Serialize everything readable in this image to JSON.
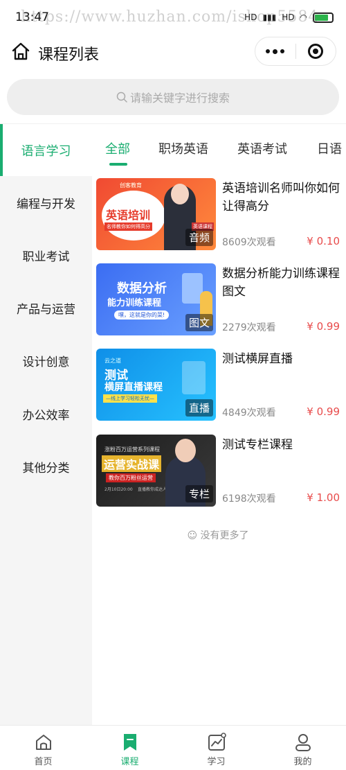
{
  "status_bar": {
    "time": "13:47",
    "network_1": "HD",
    "network_2": "HD"
  },
  "watermark": "https://www.huzhan.com/ishop5584",
  "header": {
    "title": "课程列表"
  },
  "search": {
    "placeholder": "请输关键字进行搜索"
  },
  "primary_category": "语言学习",
  "tabs": [
    "全部",
    "职场英语",
    "英语考试",
    "日语"
  ],
  "sidebar": {
    "items": [
      "编程与开发",
      "职业考试",
      "产品与运营",
      "设计创意",
      "办公效率",
      "其他分类"
    ]
  },
  "courses": [
    {
      "title": "英语培训名师叫你如何让得高分",
      "views": "8609次观看",
      "price": "¥ 0.10",
      "badge": "音频",
      "thumb_top": "创客教育",
      "thumb_main": "英语培训",
      "thumb_sub": "名师教你如何得高分",
      "thumb_tag": "英语课程"
    },
    {
      "title": "数据分析能力训练课程图文",
      "views": "2279次观看",
      "price": "¥ 0.99",
      "badge": "图文",
      "thumb_main": "数据分析",
      "thumb_main2": "能力训练课程",
      "thumb_sub": "嘿，这就是你的菜!"
    },
    {
      "title": "测试横屏直播",
      "views": "4849次观看",
      "price": "¥ 0.99",
      "badge": "直播",
      "thumb_top": "云之道",
      "thumb_main": "测试",
      "thumb_main2": "横屏直播课程",
      "thumb_sub": "—线上学习轻松无忧—"
    },
    {
      "title": "测试专栏课程",
      "views": "6198次观看",
      "price": "¥ 1.00",
      "badge": "专栏",
      "thumb_top": "涨粉百万运营系列课程",
      "thumb_main": "运营实战课",
      "thumb_sub": "教你百万粉丝运营",
      "thumb_date": "2月10日20:00",
      "thumb_note": "直播教你成达人"
    }
  ],
  "no_more": "没有更多了",
  "tabbar": {
    "items": [
      "首页",
      "课程",
      "学习",
      "我的"
    ]
  },
  "colors": {
    "accent": "#1aad70",
    "price": "#e84b4b"
  }
}
